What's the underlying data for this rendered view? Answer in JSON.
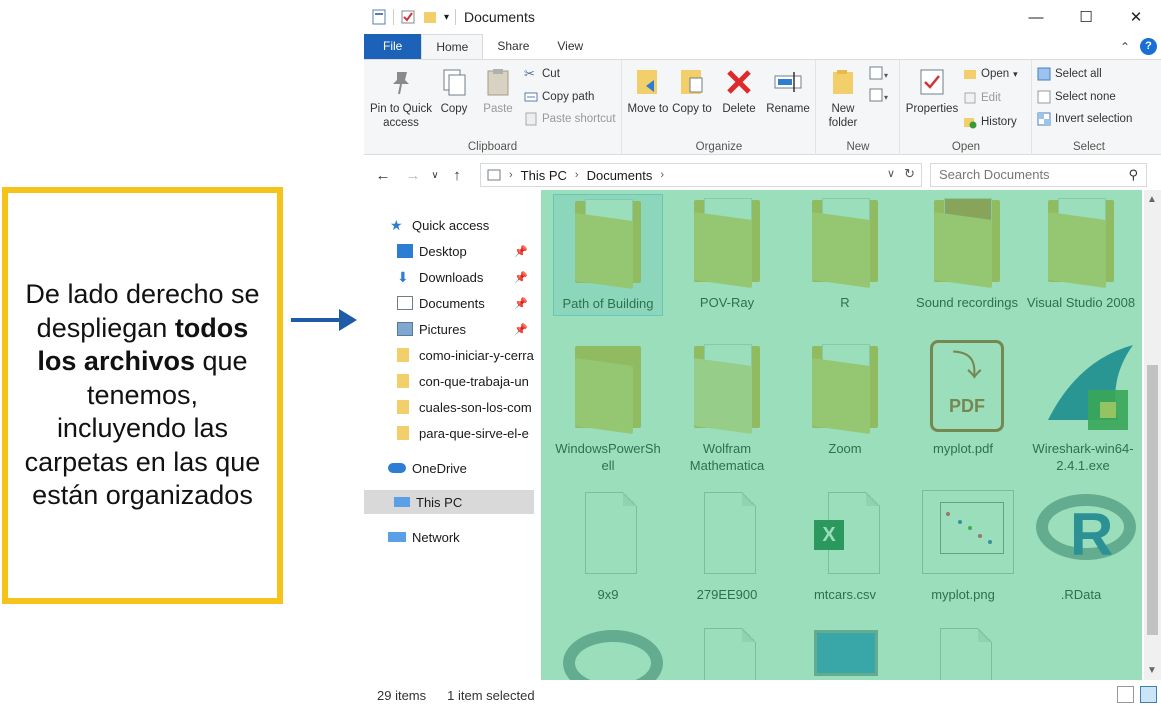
{
  "annotation": {
    "line1": "De lado derecho se despliegan",
    "bold": "todos los archivos",
    "line2": "que tenemos, incluyendo las carpetas en las que están organizados"
  },
  "window": {
    "title": "Documents",
    "controls": {
      "minimize": "—",
      "maximize": "☐",
      "close": "✕"
    }
  },
  "ribbon_tabs": [
    "File",
    "Home",
    "Share",
    "View"
  ],
  "ribbon": {
    "clipboard": {
      "name": "Clipboard",
      "pin": "Pin to Quick access",
      "copy": "Copy",
      "paste": "Paste",
      "cut": "Cut",
      "copy_path": "Copy path",
      "paste_shortcut": "Paste shortcut"
    },
    "organize": {
      "name": "Organize",
      "move_to": "Move to",
      "copy_to": "Copy to",
      "delete": "Delete",
      "rename": "Rename"
    },
    "new": {
      "name": "New",
      "new_folder": "New folder"
    },
    "open": {
      "name": "Open",
      "properties": "Properties",
      "open": "Open",
      "edit": "Edit",
      "history": "History"
    },
    "select": {
      "name": "Select",
      "select_all": "Select all",
      "select_none": "Select none",
      "invert": "Invert selection"
    }
  },
  "address": {
    "crumbs": [
      "This PC",
      "Documents"
    ],
    "search_placeholder": "Search Documents"
  },
  "nav": {
    "quick_access": "Quick access",
    "items": [
      {
        "label": "Desktop",
        "pinned": true
      },
      {
        "label": "Downloads",
        "pinned": true
      },
      {
        "label": "Documents",
        "pinned": true
      },
      {
        "label": "Pictures",
        "pinned": true
      },
      {
        "label": "como-iniciar-y-cerrar",
        "pinned": false
      },
      {
        "label": "con-que-trabaja-un",
        "pinned": false
      },
      {
        "label": "cuales-son-los-com",
        "pinned": false
      },
      {
        "label": "para-que-sirve-el-e",
        "pinned": false
      }
    ],
    "onedrive": "OneDrive",
    "this_pc": "This PC",
    "network": "Network"
  },
  "files": [
    {
      "name": "Path of Building",
      "type": "folder"
    },
    {
      "name": "POV-Ray",
      "type": "folder"
    },
    {
      "name": "R",
      "type": "folder"
    },
    {
      "name": "Sound recordings",
      "type": "folder"
    },
    {
      "name": "Visual Studio 2008",
      "type": "folder"
    },
    {
      "name": "WindowsPowerShell",
      "type": "folder"
    },
    {
      "name": "Wolfram Mathematica",
      "type": "folder"
    },
    {
      "name": "Zoom",
      "type": "folder"
    },
    {
      "name": "myplot.pdf",
      "type": "pdf"
    },
    {
      "name": "Wireshark-win64-2.4.1.exe",
      "type": "exe"
    },
    {
      "name": "9x9",
      "type": "file"
    },
    {
      "name": "279EE900",
      "type": "file"
    },
    {
      "name": "mtcars.csv",
      "type": "excel"
    },
    {
      "name": "myplot.png",
      "type": "image"
    },
    {
      "name": ".RData",
      "type": "rdata"
    }
  ],
  "pdf_badge": "PDF",
  "excel_badge": "X",
  "r_badge": "R",
  "status": {
    "count": "29 items",
    "selected": "1 item selected"
  },
  "colors": {
    "accent": "#1c62b9",
    "annotation_border": "#f6c31a",
    "overlay": "#38bd78",
    "arrow": "#1f5aa6"
  }
}
